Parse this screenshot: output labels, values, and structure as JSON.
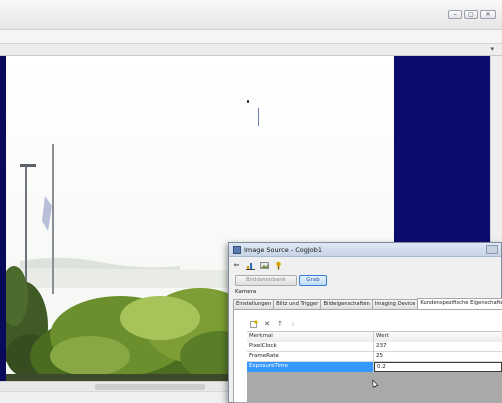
{
  "window": {
    "buttons": {
      "minimize": "‒",
      "maximize": "▢",
      "close": "✕"
    }
  },
  "dialog": {
    "title": "Image Source - CogJob1",
    "buttons": {
      "image_db": "Bilddatenbank",
      "grab": "Grab"
    },
    "group_label": "Kamera",
    "tabs": [
      {
        "label": "Einstellungen",
        "active": false
      },
      {
        "label": "Blitz und Trigger",
        "active": false
      },
      {
        "label": "Bildeigenschaften",
        "active": false
      },
      {
        "label": "Imaging Device",
        "active": false
      },
      {
        "label": "Kundenspezifische Eigenschaften",
        "active": true
      }
    ],
    "grid": {
      "columns": {
        "name": "Merkmal",
        "value": "Wert"
      },
      "rows": [
        {
          "name": "PixelClock",
          "value": "237"
        },
        {
          "name": "FrameRate",
          "value": "25"
        },
        {
          "name": "ExposureTime",
          "value": "0.2"
        }
      ],
      "selected_row": 2
    }
  },
  "colors": {
    "accent": "#3399ff",
    "navy_background": "#0c0c6e",
    "title_bar": "#c7d5e8"
  },
  "icons": {
    "dialog_toolbar": [
      "back-arrow-icon",
      "bar-chart-icon",
      "image-icon",
      "question-icon"
    ],
    "grid_toolbar": [
      "new-row-icon",
      "delete-icon",
      "move-up-icon",
      "move-down-icon"
    ]
  }
}
